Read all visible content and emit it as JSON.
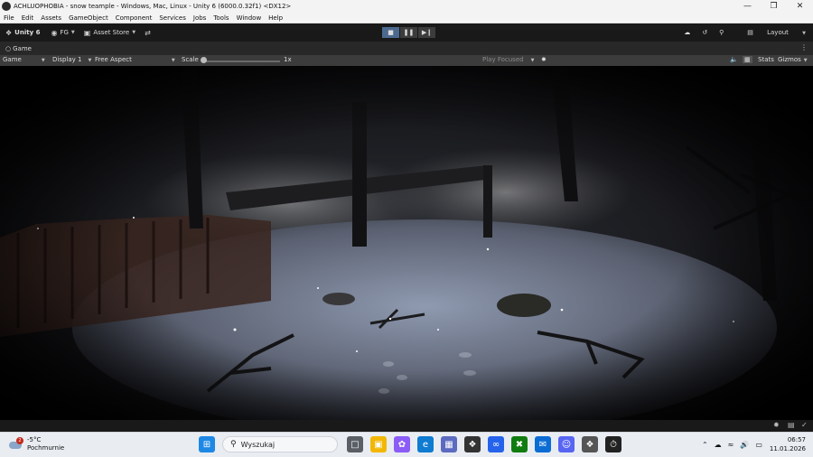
{
  "window": {
    "title": "ACHLUOPHOBIA - snow teample - Windows, Mac, Linux - Unity 6 (6000.0.32f1) <DX12>",
    "controls": [
      "—",
      "❐",
      "✕"
    ]
  },
  "menu": [
    "File",
    "Edit",
    "Assets",
    "GameObject",
    "Component",
    "Services",
    "Jobs",
    "Tools",
    "Window",
    "Help"
  ],
  "toolbar": {
    "unity_label": "Unity 6",
    "account_label": "FG",
    "asset_store_label": "Asset Store",
    "layout_label": "Layout"
  },
  "play_controls": {
    "play_active": true
  },
  "tab": {
    "label": "Game"
  },
  "game_bar": {
    "view_dropdown": "Game",
    "display_dropdown": "Display 1",
    "aspect_dropdown": "Free Aspect",
    "scale_label": "Scale",
    "scale_value": "1x",
    "scale_fraction": 0.0,
    "play_focus_dropdown": "Play Focused",
    "stats_label": "Stats",
    "gizmos_label": "Gizmos"
  },
  "taskbar": {
    "weather_temp": "-5°C",
    "weather_desc": "Pochmurnie",
    "weather_badge": "2",
    "search_placeholder": "Wyszukaj",
    "time": "06:57",
    "date": "11.01.2026"
  },
  "colors": {
    "accent_play": "#4c6a90",
    "snow": "#8f9ab0",
    "dark": "#0a0a0c"
  }
}
